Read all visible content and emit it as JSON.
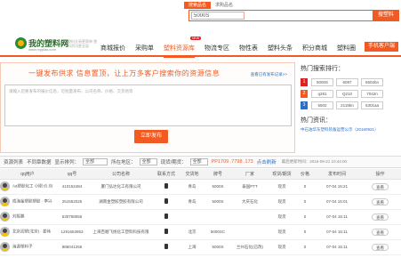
{
  "search": {
    "tabs": [
      "搜索品名",
      "求购品名"
    ],
    "value": "5000S",
    "button_label": "搜塑料"
  },
  "header": {
    "logo_name": "我的塑料网",
    "logo_url": "www.myplas.com",
    "slogan": "塑料交易更简单 塑料资讯更全面",
    "nav": [
      "商城报价",
      "采购单",
      "塑料资源库",
      "物流专区",
      "物性表",
      "塑料头条",
      "积分商城",
      "塑料圈"
    ],
    "new_badge": "NEW",
    "app_button": "手机客户端"
  },
  "publish": {
    "title": "一键发布供求 信息置顶，让上万多客户搜索你的资源信息",
    "link": "查看已有发布记录>>",
    "placeholder": "请输入您要发布的报价信息，可批量发布，公司名称、价格、交货地等",
    "button": "立即发布"
  },
  "hot": {
    "title": "热门搜索排行：",
    "rows": [
      {
        "num": "1",
        "color": "#e02020",
        "cells": [
          "5000S",
          "6097",
          "5502bn"
        ]
      },
      {
        "num": "2",
        "color": "#f15a22",
        "cells": [
          "q281",
          "Q210",
          "7042n"
        ]
      },
      {
        "num": "3",
        "color": "#2b6fc4",
        "cells": [
          "5502",
          "2119bn",
          "5301aa"
        ]
      }
    ],
    "news_title": "热门资讯：",
    "news_item": "中石油华东塑料装备运营公示（20160921）"
  },
  "filter": {
    "label1": "资源列表",
    "label2": "不同章数据",
    "label3": "显示排列：",
    "select1": "全部",
    "label4": "所在地区：",
    "select2": "全部",
    "label5": "现货/期货：",
    "select3": "全部",
    "highlight": "PP1709 .7798 .173",
    "blue_text": "点击刷新",
    "last_update": "最后更新时间：2016-09-21 10:44:00"
  },
  "table": {
    "headers": [
      "qq用户",
      "qq号",
      "公司名称",
      "联系方式",
      "交货地",
      "牌号",
      "厂家",
      "现货/期货",
      "价格",
      "发布时间",
      "操作"
    ],
    "rows": [
      [
        "Aa塑胶化工 小刚 价.包",
        "410152484",
        "厦门弘达化工有限公司",
        "",
        "青岛",
        "5000S",
        "泰国PTT",
        "现货",
        "0",
        "07-04 15:21",
        "查看"
      ],
      [
        "成海金塑胶塑胶 · 李兴",
        "251552025",
        "湖南金塑胶塑胶有限公司",
        "",
        "青岛",
        "5000S",
        "大庆石化",
        "现货",
        "0",
        "07-04 15:01",
        "查看"
      ],
      [
        "刘振鹏",
        "530758556",
        "",
        "",
        "",
        "",
        "",
        "现货",
        "0",
        "07-04 15:11",
        "查看"
      ],
      [
        "北京润塑(北京) · 姜伟",
        "1291653953",
        "上海百顺飞扬化工塑料科技有限",
        "",
        "北京",
        "5000SC",
        "",
        "现货",
        "0",
        "07-04 15:11",
        "查看"
      ],
      [
        "海源塑料子",
        "986041256",
        "",
        "",
        "上海",
        "5000S",
        "兰州石化(已改)",
        "现货",
        "0",
        "07-04 15:11",
        "查看"
      ]
    ],
    "phone_icon": "phone-icon"
  }
}
